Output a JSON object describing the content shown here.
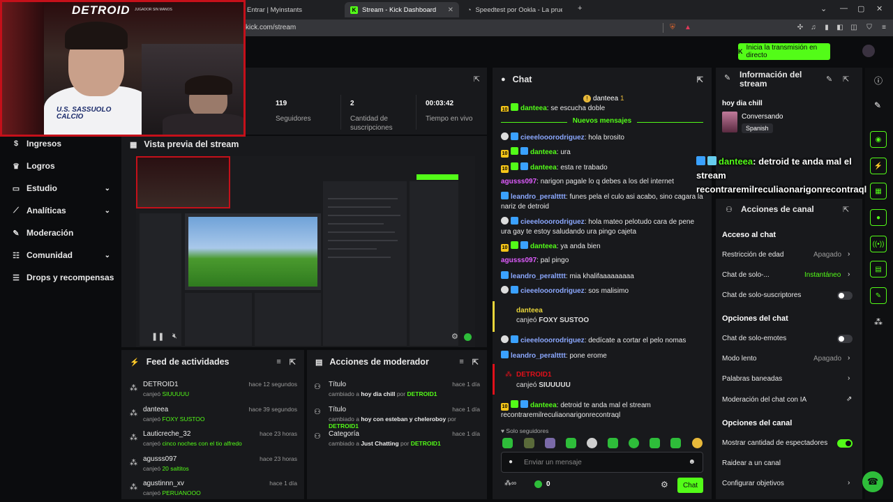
{
  "browser": {
    "tabs": [
      {
        "label": "Entrar | Myinstants"
      },
      {
        "label": "Stream - Kick Dashboard"
      },
      {
        "label": "Speedtest por Ookla - La prueba de ..."
      }
    ],
    "url": "kick.com/stream",
    "new_tab": "+"
  },
  "header": {
    "go_live": "Inicia la transmisión en directo"
  },
  "webcam": {
    "logo": "DETROID",
    "subtitle": "JUGADOR SIN MANOS",
    "shirt_text": "U.S. SASSUOLO CALCIO"
  },
  "sidebar": {
    "items": [
      {
        "label": "Ingresos",
        "icon": "dollar-icon",
        "chevron": false
      },
      {
        "label": "Logros",
        "icon": "trophy-icon",
        "chevron": false
      },
      {
        "label": "Estudio",
        "icon": "studio-icon",
        "chevron": true
      },
      {
        "label": "Analíticas",
        "icon": "analytics-icon",
        "chevron": true
      },
      {
        "label": "Moderación",
        "icon": "wrench-icon",
        "chevron": false
      },
      {
        "label": "Comunidad",
        "icon": "community-icon",
        "chevron": true
      },
      {
        "label": "Drops y recompensas",
        "icon": "drops-icon",
        "chevron": false
      }
    ]
  },
  "stats": {
    "followers_value": "119",
    "followers_label": "Seguidores",
    "subs_value": "2",
    "subs_label": "Cantidad de suscripciones",
    "live_value": "00:03:42",
    "live_label": "Tiempo en vivo"
  },
  "preview": {
    "title": "Vista previa del stream"
  },
  "activity_feed": {
    "title": "Feed de actividades",
    "items": [
      {
        "name": "DETROID1",
        "time": "hace 12 segundos",
        "action": "canjeó",
        "reward": "SIUUUUU"
      },
      {
        "name": "danteea",
        "time": "hace 39 segundos",
        "action": "canjeó",
        "reward": "FOXY SUSTOO"
      },
      {
        "name": "Lauticreche_32",
        "time": "hace 23 horas",
        "action": "canjeó",
        "reward": "cinco noches con el tio alfredo"
      },
      {
        "name": "agusss097",
        "time": "hace 23 horas",
        "action": "canjeó",
        "reward": "20 saltitos"
      },
      {
        "name": "agustinnn_xv",
        "time": "hace 1 día",
        "action": "canjeó",
        "reward": "PERUANOOO"
      }
    ]
  },
  "mod_actions": {
    "title": "Acciones de moderador",
    "items": [
      {
        "name": "Título",
        "time": "hace 1 día",
        "prefix": "cambiado a",
        "value": "hoy dia chill",
        "by": "por",
        "user": "DETROID1"
      },
      {
        "name": "Título",
        "time": "hace 1 día",
        "prefix": "cambiado a",
        "value": "hoy con esteban y cheleroboy",
        "by": "por",
        "user": "DETROID1"
      },
      {
        "name": "Categoría",
        "time": "hace 1 día",
        "prefix": "cambiado a",
        "value": "Just Chatting",
        "by": "por",
        "user": "DETROID1"
      }
    ]
  },
  "chat": {
    "title": "Chat",
    "pinned_user": "danteea",
    "pinned_count": "1",
    "top_line": {
      "user": "danteea",
      "text": "se escucha doble"
    },
    "new_messages": "Nuevos mensajes",
    "messages": [
      {
        "user": "cieeelooorodriguez",
        "text": "hola brosito"
      },
      {
        "user": "danteea",
        "text": "ura"
      },
      {
        "user": "danteea",
        "text": "esta re trabado"
      },
      {
        "user": "agusss097",
        "text": "narigon pagale lo q debes a los del internet"
      },
      {
        "user": "leandro_peraltttt",
        "text": "funes pela el culo asi acabo, sino cagara la nariz de detroid"
      },
      {
        "user": "cieeelooorodriguez",
        "text": "hola mateo pelotudo cara de pene ura gay te estoy saludando ura pingo cajeta"
      },
      {
        "user": "danteea",
        "text": "ya anda bien"
      },
      {
        "user": "agusss097",
        "text": "pal pingo"
      },
      {
        "user": "leandro_peraltttt",
        "text": "mia khalifaaaaaaaaa"
      },
      {
        "user": "cieeelooorodriguez",
        "text": "sos malisimo"
      }
    ],
    "redeem1": {
      "user": "danteea",
      "action": "canjeó",
      "reward": "FOXY SUSTOO"
    },
    "messages2": [
      {
        "user": "cieeelooorodriguez",
        "text": "dedícate a cortar el pelo nomas"
      },
      {
        "user": "leandro_peraltttt",
        "text": "pone erome"
      }
    ],
    "redeem2": {
      "user": "DETROID1",
      "action": "canjeó",
      "reward": "SIUUUUU"
    },
    "last": {
      "user": "danteea",
      "text": "detroid te anda mal el stream recontraremilreculiaonarigonrecontraql"
    },
    "followers_only": "Solo seguidores",
    "input_placeholder": "Enviar un mensaje",
    "points": "0",
    "send": "Chat"
  },
  "overlay_chat": {
    "user": "danteea",
    "text": ": detroid te anda mal el stream recontraremilreculiaonarigonrecontraql"
  },
  "stream_info": {
    "title": "Información del stream",
    "stream_title": "hoy dia chill",
    "category": "Conversando",
    "language": "Spanish"
  },
  "channel_actions": {
    "title": "Acciones de canal",
    "chat_access": "Acceso al chat",
    "age_restriction": "Restricción de edad",
    "age_restriction_value": "Apagado",
    "followers_only": "Chat de solo-...",
    "followers_only_value": "Instantáneo",
    "subs_only": "Chat de solo-suscriptores",
    "chat_options": "Opciones del chat",
    "emotes_only": "Chat de solo-emotes",
    "slow_mode": "Modo lento",
    "slow_mode_value": "Apagado",
    "banned_words": "Palabras baneadas",
    "ai_moderation": "Moderación del chat con IA",
    "channel_options": "Opciones del canal",
    "show_viewers": "Mostrar cantidad de espectadores",
    "raid": "Raidear a un canal",
    "goals": "Configurar objetivos"
  },
  "colors": {
    "accent": "#53fc18",
    "webcam_border": "#c5101a",
    "panel": "#18191c",
    "background": "#0b0c0e"
  }
}
